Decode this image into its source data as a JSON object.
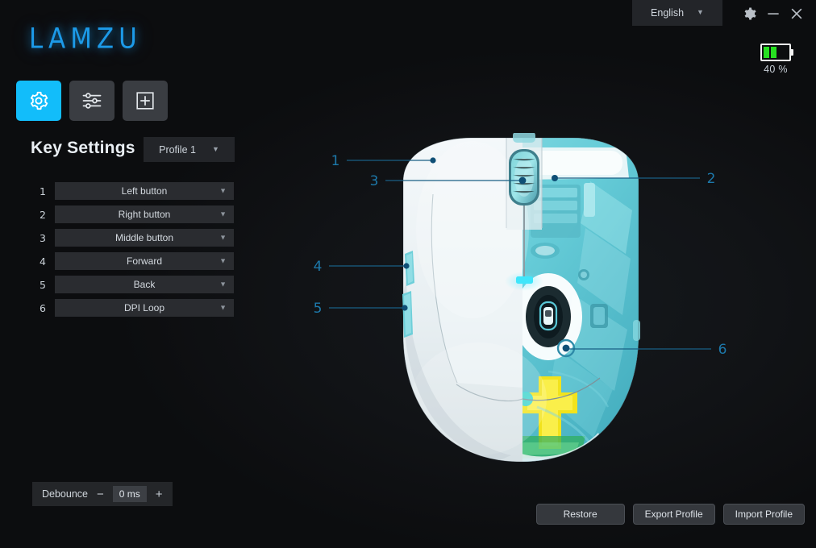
{
  "window": {
    "language_label": "English",
    "language_chevron": "chevron-down-icon",
    "gear_icon": "gear-icon",
    "minimize_icon": "minimize-icon",
    "close_icon": "close-icon"
  },
  "battery": {
    "percent_label": "40 %",
    "level": 40,
    "bars_filled": 2,
    "bar_color": "#27e021",
    "outline_color": "#f2f2f2"
  },
  "brand": {
    "logo_text": "LAMZU",
    "logo_color": "#1c9ae8"
  },
  "theme": {
    "accent": "#12bdfa",
    "background": "#0d0d0f",
    "panel": "#2a2c30",
    "text": "#d8dde3",
    "callout_blue": "#1d79ab"
  },
  "toolbar": {
    "items": [
      {
        "name": "settings",
        "icon": "gear-icon",
        "active": true
      },
      {
        "name": "performance",
        "icon": "sliders-icon",
        "active": false
      },
      {
        "name": "add-macro",
        "icon": "add-box-icon",
        "active": false
      }
    ]
  },
  "key_settings": {
    "title": "Key Settings",
    "profile": {
      "value": "Profile 1",
      "chevron": "chevron-down-icon"
    },
    "rows": [
      {
        "index": "1",
        "value": "Left button"
      },
      {
        "index": "2",
        "value": "Right button"
      },
      {
        "index": "3",
        "value": "Middle button"
      },
      {
        "index": "4",
        "value": "Forward"
      },
      {
        "index": "5",
        "value": "Back"
      },
      {
        "index": "6",
        "value": "DPI Loop"
      }
    ]
  },
  "debounce": {
    "label": "Debounce",
    "minus": "−",
    "value": "0 ms",
    "plus": "+"
  },
  "actions": {
    "restore": "Restore",
    "export_profile": "Export Profile",
    "import_profile": "Import Profile"
  },
  "mouse_diagram": {
    "description": "Top view of a white wireless gaming mouse, right half cut away to reveal transparent cyan internals",
    "callouts": [
      {
        "id": "1",
        "label": "1",
        "target": "left-button"
      },
      {
        "id": "2",
        "label": "2",
        "target": "right-button"
      },
      {
        "id": "3",
        "label": "3",
        "target": "scroll-wheel"
      },
      {
        "id": "4",
        "label": "4",
        "target": "side-button-forward"
      },
      {
        "id": "5",
        "label": "5",
        "target": "side-button-back"
      },
      {
        "id": "6",
        "label": "6",
        "target": "dpi-button"
      }
    ]
  }
}
